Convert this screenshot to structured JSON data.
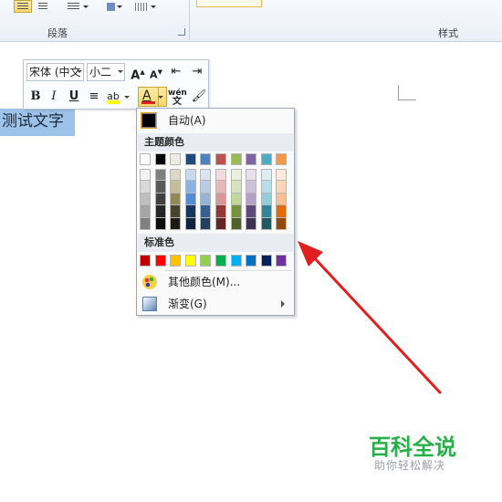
{
  "ribbon": {
    "paragraph_group_label": "段落",
    "styles_group_label": "样式"
  },
  "document": {
    "selected_text": "测试文字"
  },
  "mini_toolbar": {
    "font_name": "宋体 (中文",
    "font_size": "小二",
    "grow_font_icon": "A",
    "shrink_font_icon": "A",
    "bold": "B",
    "italic": "I",
    "underline": "U",
    "highlight_icon": "ab",
    "font_color_letter": "A",
    "pinyin_icon": "wén",
    "font_color_bar": "#e02020",
    "highlight_bar": "#ffff00"
  },
  "color_menu": {
    "automatic_label": "自动(A)",
    "theme_colors_header": "主题颜色",
    "standard_colors_header": "标准色",
    "more_colors_label": "其他颜色(M)...",
    "gradient_label": "渐变(G)",
    "theme_colors": [
      [
        "#ffffff",
        "#f2f2f2",
        "#d9d9d9",
        "#bfbfbf",
        "#a6a6a6",
        "#808080"
      ],
      [
        "#000000",
        "#7f7f7f",
        "#595959",
        "#404040",
        "#262626",
        "#0d0d0d"
      ],
      [
        "#eeece1",
        "#ddd9c3",
        "#c4bd97",
        "#938953",
        "#494429",
        "#1d1b10"
      ],
      [
        "#1f497d",
        "#c6d9f0",
        "#8db3e2",
        "#548dd4",
        "#17365d",
        "#0f243e"
      ],
      [
        "#4f81bd",
        "#dbe5f1",
        "#b8cce4",
        "#95b3d7",
        "#366092",
        "#244061"
      ],
      [
        "#c0504d",
        "#f2dcdb",
        "#e5b9b7",
        "#d99694",
        "#953734",
        "#632423"
      ],
      [
        "#9bbb59",
        "#ebf1dd",
        "#d7e3bc",
        "#c3d69b",
        "#76923c",
        "#4f6128"
      ],
      [
        "#8064a2",
        "#e5e0ec",
        "#ccc1d9",
        "#b2a2c7",
        "#5f497a",
        "#3f3151"
      ],
      [
        "#4bacc6",
        "#dbeef3",
        "#b7dde8",
        "#92cddc",
        "#31859b",
        "#205867"
      ],
      [
        "#f79646",
        "#fdeada",
        "#fbd5b5",
        "#fac08f",
        "#e36c09",
        "#974806"
      ]
    ],
    "standard_colors": [
      "#c00000",
      "#ff0000",
      "#ffc000",
      "#ffff00",
      "#92d050",
      "#00b050",
      "#00b0f0",
      "#0070c0",
      "#002060",
      "#7030a0"
    ]
  },
  "annotation": {
    "arrow_color": "#e02020"
  },
  "watermark": {
    "title": "百科全说",
    "subtitle": "助你轻松解决"
  }
}
